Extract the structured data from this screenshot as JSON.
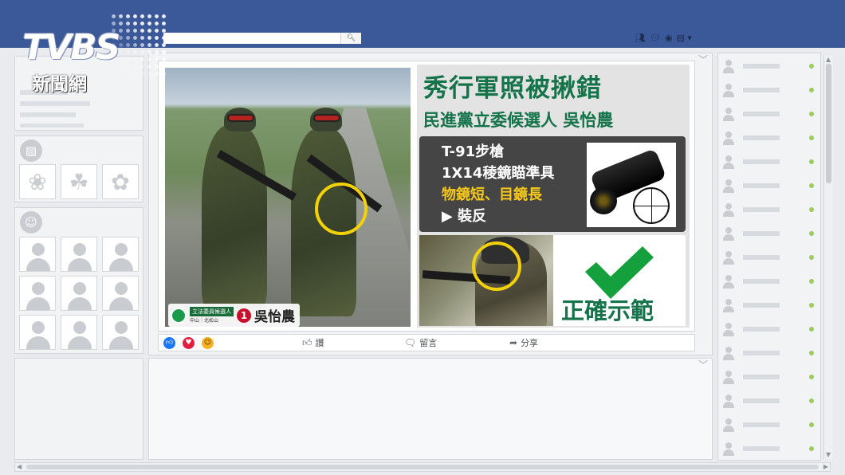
{
  "logo": {
    "brand": "TVBS",
    "subtitle": "新聞網"
  },
  "topbar": {
    "search_icon": "search-icon",
    "icons": [
      "friends-icon",
      "messages-icon",
      "globe-icon",
      "account-menu-icon"
    ]
  },
  "post": {
    "image": {
      "headline": "秀行軍照被揪錯",
      "subheadline": "民進黨立委候選人 吳怡農",
      "spec_line1": "T-91步槍",
      "spec_line2": "1X14稜鏡瞄準具",
      "spec_line3": "物鏡短、目鏡長",
      "spec_arrow": "▶",
      "spec_line4": "裝反",
      "correct_label": "正確示範",
      "badge_role": "立法委員候選人",
      "badge_area": "中山｜北松山",
      "badge_number": "1",
      "badge_name": "吳怡農"
    },
    "actions": {
      "like": "讚",
      "comment": "留言",
      "share": "分享"
    }
  },
  "colors": {
    "facebook_blue": "#3b5998",
    "headline_green": "#15734a",
    "highlight_yellow": "#f5c81b",
    "ring_yellow": "#f2d10a",
    "online_green": "#9ccb5f"
  }
}
